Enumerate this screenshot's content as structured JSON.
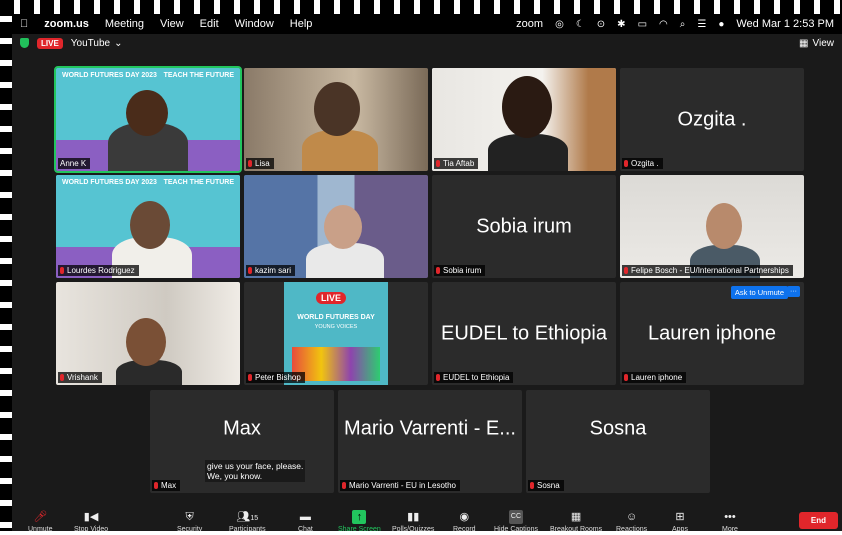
{
  "menubar": {
    "apple": "",
    "app": "zoom.us",
    "items": [
      "Meeting",
      "View",
      "Edit",
      "Window",
      "Help"
    ],
    "zoom_label": "zoom",
    "datetime": "Wed Mar 1  2:53 PM"
  },
  "topbar": {
    "live": "LIVE",
    "stream": "YouTube",
    "view": "View"
  },
  "tiles": [
    {
      "name": "Anne K",
      "banner_left": "WORLD FUTURES DAY 2023",
      "banner_right": "TEACH THE FUTURE"
    },
    {
      "name": "Lisa"
    },
    {
      "name": "Tia Aftab"
    },
    {
      "name": "Ozgita .",
      "big": "Ozgita ."
    },
    {
      "name": "Lourdes Rodriguez",
      "banner_left": "WORLD FUTURES DAY 2023",
      "banner_right": "TEACH THE FUTURE"
    },
    {
      "name": "kazim sari"
    },
    {
      "name": "Sobia irum",
      "big": "Sobia irum"
    },
    {
      "name": "Felipe Bosch - EU/International Partnerships"
    },
    {
      "name": "Vrishank"
    },
    {
      "name": "Peter Bishop",
      "poster_live": "LIVE",
      "poster_title": "WORLD FUTURES DAY",
      "poster_sub": "YOUNG VOICES"
    },
    {
      "name": "EUDEL to Ethiopia",
      "big": "EUDEL to Ethiopia"
    },
    {
      "name": "Lauren iphone",
      "big": "Lauren iphone",
      "ask": "Ask to Unmute",
      "more": "···"
    },
    {
      "name": "Max",
      "big": "Max"
    },
    {
      "name": "Mario Varrenti - EU in Lesotho",
      "big": "Mario Varrenti - E..."
    },
    {
      "name": "Sosna",
      "big": "Sosna"
    }
  ],
  "caption": {
    "line1": "give us your face, please.",
    "line2": "We, you know."
  },
  "toolbar": {
    "unmute": "Unmute",
    "stop_video": "Stop Video",
    "security": "Security",
    "participants": "Participants",
    "participants_count": "15",
    "chat": "Chat",
    "share": "Share Screen",
    "polls": "Polls/Quizzes",
    "record": "Record",
    "captions": "Hide Captions",
    "cc": "CC",
    "breakout": "Breakout Rooms",
    "reactions": "Reactions",
    "apps": "Apps",
    "more": "More",
    "end": "End"
  }
}
